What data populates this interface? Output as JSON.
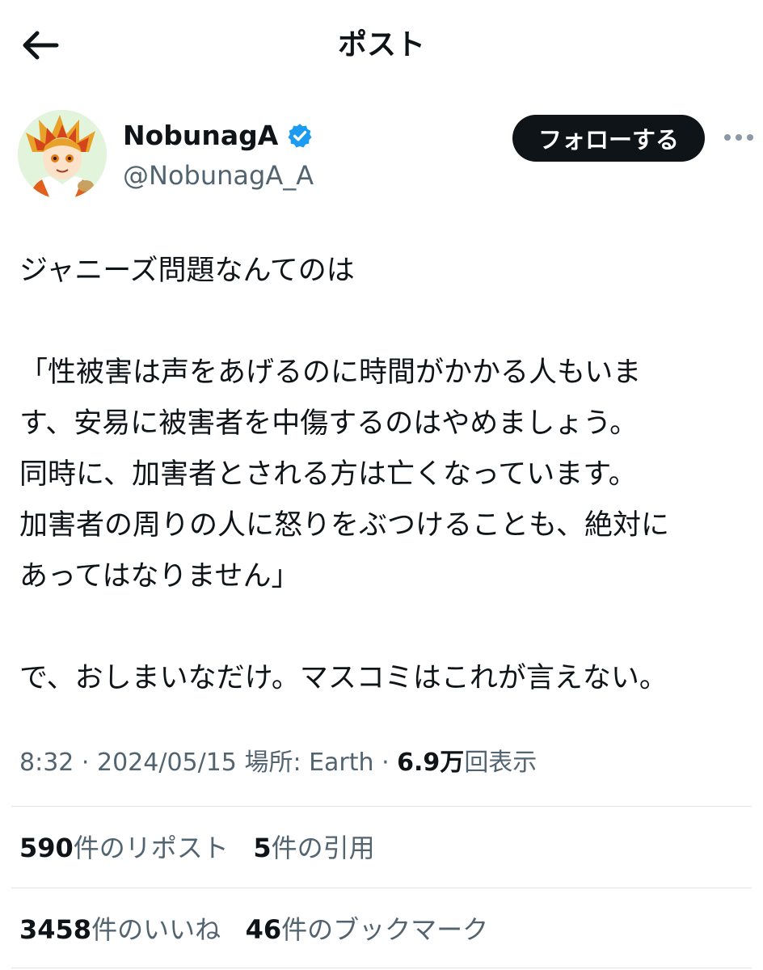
{
  "header": {
    "title": "ポスト",
    "back_icon": "arrow-left-icon"
  },
  "author": {
    "display_name": "NobunagA",
    "handle": "@NobunagA_A",
    "verified_color": "#1d9bf0",
    "follow_label": "フォローする",
    "more_icon": "more-horizontal-icon"
  },
  "post": {
    "lines": [
      "ジャニーズ問題なんてのは",
      "",
      "「性被害は声をあげるのに時間がかかる人もいま",
      "す、安易に被害者を中傷するのはやめましょう。",
      "同時に、加害者とされる方は亡くなっています。",
      "加害者の周りの人に怒りをぶつけることも、絶対に",
      "あってはなりません」",
      "",
      "で、おしまいなだけ。マスコミはこれが言えない。"
    ]
  },
  "meta": {
    "time": "8:32",
    "sep1": " · ",
    "date": "2024/05/15",
    "location": "場所: Earth",
    "sep2": " · ",
    "views_num": "6.9万",
    "views_label": "回表示"
  },
  "stats": {
    "reposts_num": "590",
    "reposts_label": "件のリポスト",
    "quotes_num": "5",
    "quotes_label": "件の引用",
    "likes_num": "3458",
    "likes_label": "件のいいね",
    "bookmarks_num": "46",
    "bookmarks_label": "件のブックマーク"
  },
  "colors": {
    "text": "#0f1419",
    "secondary": "#536471",
    "divider": "#e1e6ea"
  }
}
